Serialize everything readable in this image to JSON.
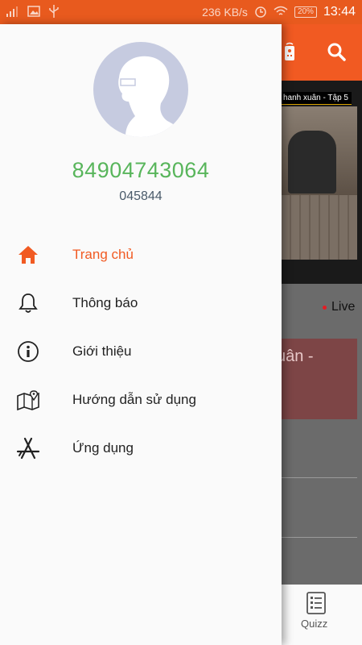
{
  "status_bar": {
    "network_speed": "236 KB/s",
    "battery": "20%",
    "time": "13:44"
  },
  "drawer": {
    "phone": "84904743064",
    "user_id": "045844",
    "menu": [
      {
        "label": "Trang chủ",
        "icon": "home-icon",
        "active": true
      },
      {
        "label": "Thông báo",
        "icon": "bell-icon",
        "active": false
      },
      {
        "label": "Giới thiệu",
        "icon": "info-icon",
        "active": false
      },
      {
        "label": "Hướng dẫn sử dụng",
        "icon": "map-icon",
        "active": false
      },
      {
        "label": "Ứng dụng",
        "icon": "app-store-icon",
        "active": false
      }
    ]
  },
  "background": {
    "video_title": "hanh xuân - Tập 5",
    "live_label": "Live",
    "card_title_fragment": "uân -",
    "bottom_nav_label": "Quizz"
  },
  "colors": {
    "accent": "#f15a22",
    "phone_green": "#58b55b",
    "live_red": "#e51c23"
  }
}
